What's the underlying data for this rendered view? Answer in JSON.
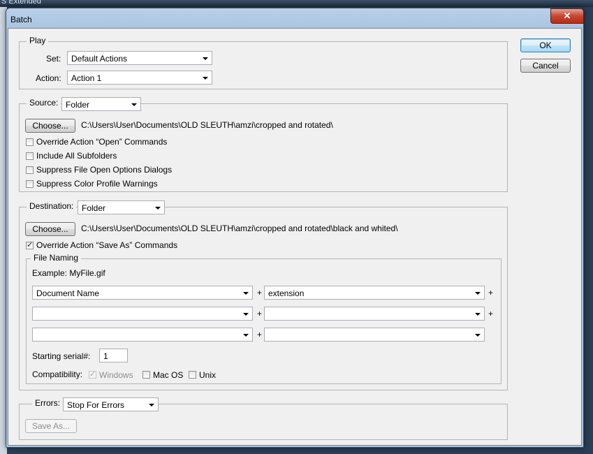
{
  "app": {
    "background_title": "S Extended",
    "window_title": "Batch",
    "close_glyph": "✕"
  },
  "buttons": {
    "ok": "OK",
    "cancel": "Cancel"
  },
  "play": {
    "legend": "Play",
    "set_label": "Set:",
    "set_value": "Default Actions",
    "action_label": "Action:",
    "action_value": "Action 1"
  },
  "source": {
    "label": "Source:",
    "value": "Folder",
    "choose_label": "Choose...",
    "path": "C:\\Users\\User\\Documents\\OLD SLEUTH\\amzi\\cropped and rotated\\",
    "options": [
      {
        "label": "Override Action “Open” Commands",
        "checked": false
      },
      {
        "label": "Include All Subfolders",
        "checked": false
      },
      {
        "label": "Suppress File Open Options Dialogs",
        "checked": false
      },
      {
        "label": "Suppress Color Profile Warnings",
        "checked": false
      }
    ]
  },
  "destination": {
    "label": "Destination:",
    "value": "Folder",
    "choose_label": "Choose...",
    "path": "C:\\Users\\User\\Documents\\OLD SLEUTH\\amzi\\cropped and rotated\\black and whited\\",
    "override_label": "Override Action “Save As” Commands",
    "override_checked": true
  },
  "file_naming": {
    "legend": "File Naming",
    "example": "Example: MyFile.gif",
    "rows": [
      {
        "left": "Document Name",
        "right": "extension"
      },
      {
        "left": "",
        "right": ""
      },
      {
        "left": "",
        "right": ""
      }
    ],
    "plus": "+",
    "serial_label": "Starting serial#:",
    "serial_value": "1",
    "compat_label": "Compatibility:",
    "compat": [
      {
        "label": "Windows",
        "checked": true,
        "disabled": true
      },
      {
        "label": "Mac OS",
        "checked": false,
        "disabled": false
      },
      {
        "label": "Unix",
        "checked": false,
        "disabled": false
      }
    ]
  },
  "errors": {
    "label": "Errors:",
    "value": "Stop For Errors",
    "save_as_label": "Save As..."
  },
  "check_glyph": "✓"
}
